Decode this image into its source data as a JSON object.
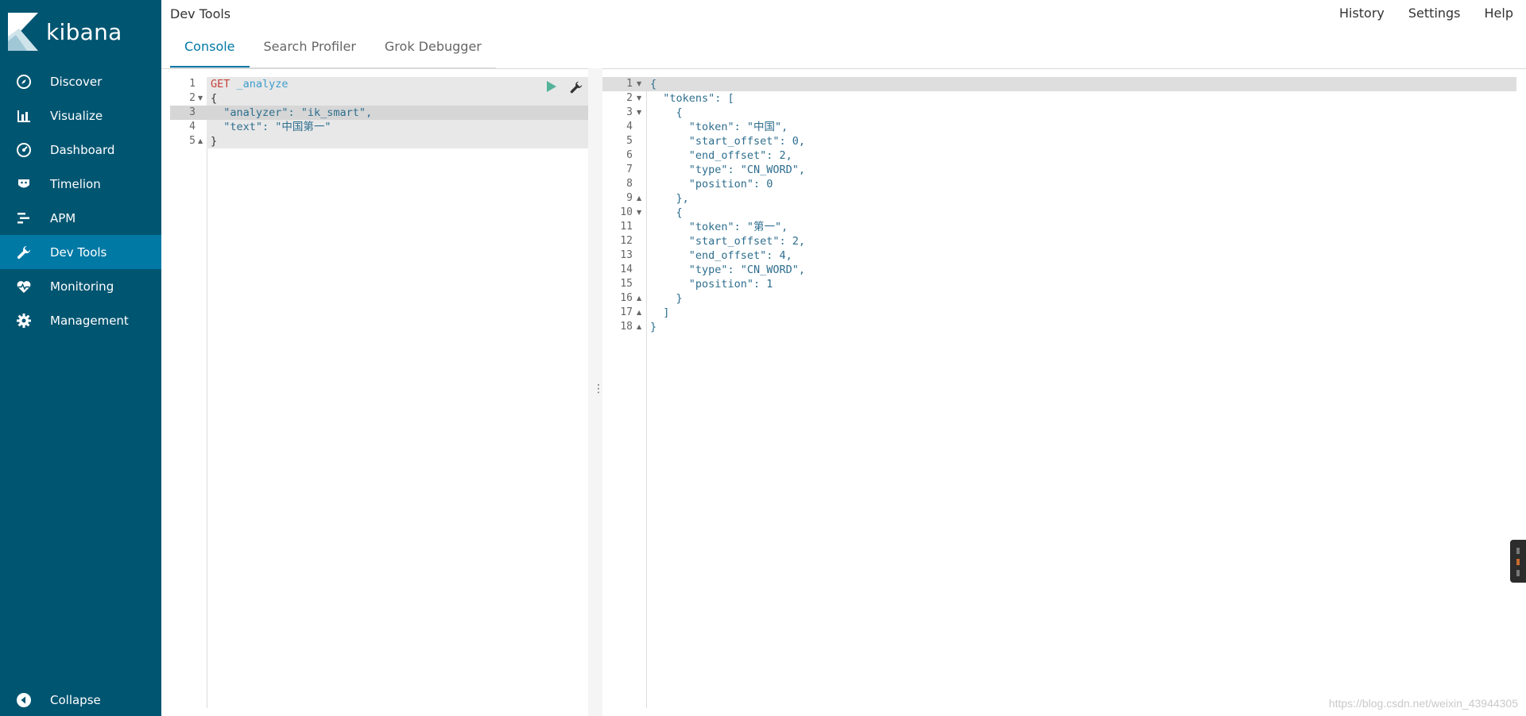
{
  "app": {
    "name": "kibana",
    "page_title": "Dev Tools"
  },
  "top_links": [
    {
      "label": "History"
    },
    {
      "label": "Settings"
    },
    {
      "label": "Help"
    }
  ],
  "tabs": [
    {
      "label": "Console",
      "active": true
    },
    {
      "label": "Search Profiler",
      "active": false
    },
    {
      "label": "Grok Debugger",
      "active": false
    }
  ],
  "sidebar": {
    "items": [
      {
        "label": "Discover",
        "icon": "compass-icon"
      },
      {
        "label": "Visualize",
        "icon": "bar-chart-icon"
      },
      {
        "label": "Dashboard",
        "icon": "dashboard-icon"
      },
      {
        "label": "Timelion",
        "icon": "timelion-icon"
      },
      {
        "label": "APM",
        "icon": "apm-icon"
      },
      {
        "label": "Dev Tools",
        "icon": "wrench-icon",
        "active": true
      },
      {
        "label": "Monitoring",
        "icon": "heartbeat-icon"
      },
      {
        "label": "Management",
        "icon": "gear-icon"
      }
    ],
    "collapse_label": "Collapse"
  },
  "request_editor": {
    "line_numbers": [
      "1",
      "2",
      "3",
      "4",
      "5"
    ],
    "method": "GET",
    "url": "_analyze",
    "lines": [
      "{",
      "  \"analyzer\": \"ik_smart\",",
      "  \"text\": \"中国第一\"",
      "}"
    ]
  },
  "response_editor": {
    "line_numbers": [
      "1",
      "2",
      "3",
      "4",
      "5",
      "6",
      "7",
      "8",
      "9",
      "10",
      "11",
      "12",
      "13",
      "14",
      "15",
      "16",
      "17",
      "18"
    ],
    "lines": [
      "{",
      "  \"tokens\": [",
      "    {",
      "      \"token\": \"中国\",",
      "      \"start_offset\": 0,",
      "      \"end_offset\": 2,",
      "      \"type\": \"CN_WORD\",",
      "      \"position\": 0",
      "    },",
      "    {",
      "      \"token\": \"第一\",",
      "      \"start_offset\": 2,",
      "      \"end_offset\": 4,",
      "      \"type\": \"CN_WORD\",",
      "      \"position\": 1",
      "    }",
      "  ]",
      "}"
    ]
  },
  "watermark": "https://blog.csdn.net/weixin_43944305",
  "colors": {
    "sidebar": "#005571",
    "active": "#0079a5"
  }
}
